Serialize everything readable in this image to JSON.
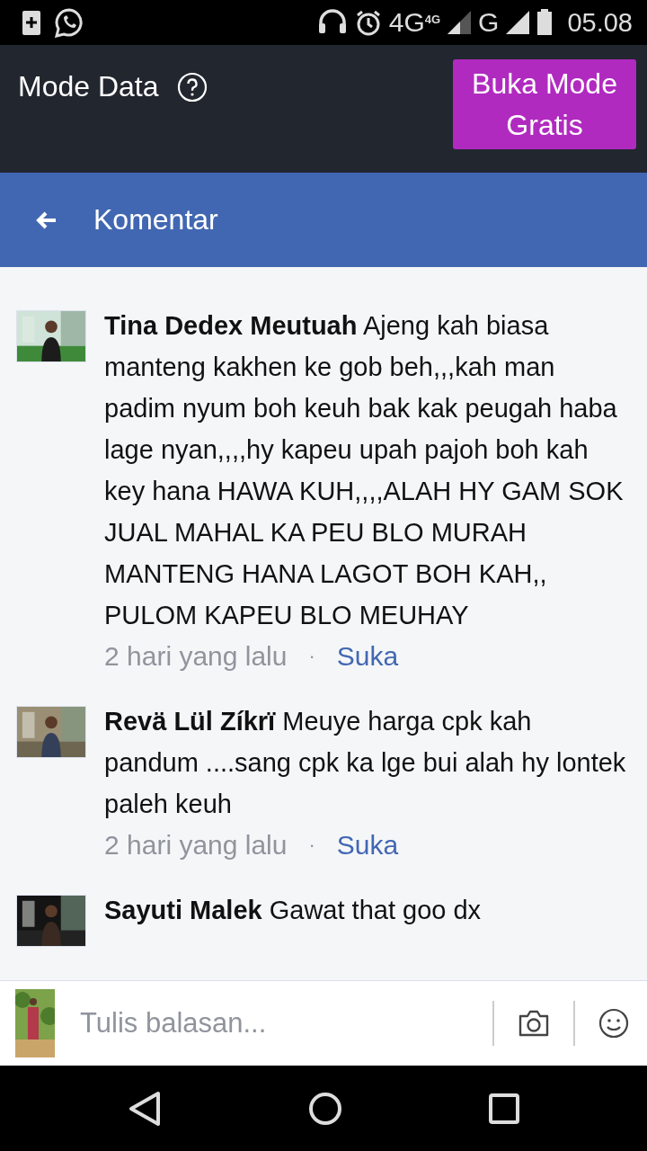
{
  "status_bar": {
    "time": "05.08",
    "network_1": "4G",
    "network_1_small": "4G",
    "network_2": "G"
  },
  "data_bar": {
    "title": "Mode Data",
    "button": "Buka Mode Gratis"
  },
  "app_bar": {
    "title": "Komentar"
  },
  "comments": [
    {
      "author": "Tina Dedex Meutuah",
      "text": "Ajeng kah biasa manteng kakhen ke gob beh,,,kah man padim nyum boh keuh bak kak peugah haba lage nyan,,,,hy kapeu upah pajoh boh kah key hana HAWA KUH,,,,ALAH HY GAM SOK JUAL MAHAL KA PEU BLO MURAH MANTENG HANA LAGOT BOH KAH,, PULOM KAPEU BLO MEUHAY",
      "time": "2 hari yang lalu",
      "separator": "·",
      "like": "Suka"
    },
    {
      "author": "Revä Lül Zíkrï",
      "text": "Meuye harga cpk kah pandum ....sang cpk ka lge bui alah hy lontek paleh keuh",
      "time": "2 hari yang lalu",
      "separator": "·",
      "like": "Suka"
    },
    {
      "author": "Sayuti Malek",
      "text": "Gawat that goo dx"
    }
  ],
  "reply": {
    "placeholder": "Tulis balasan..."
  }
}
